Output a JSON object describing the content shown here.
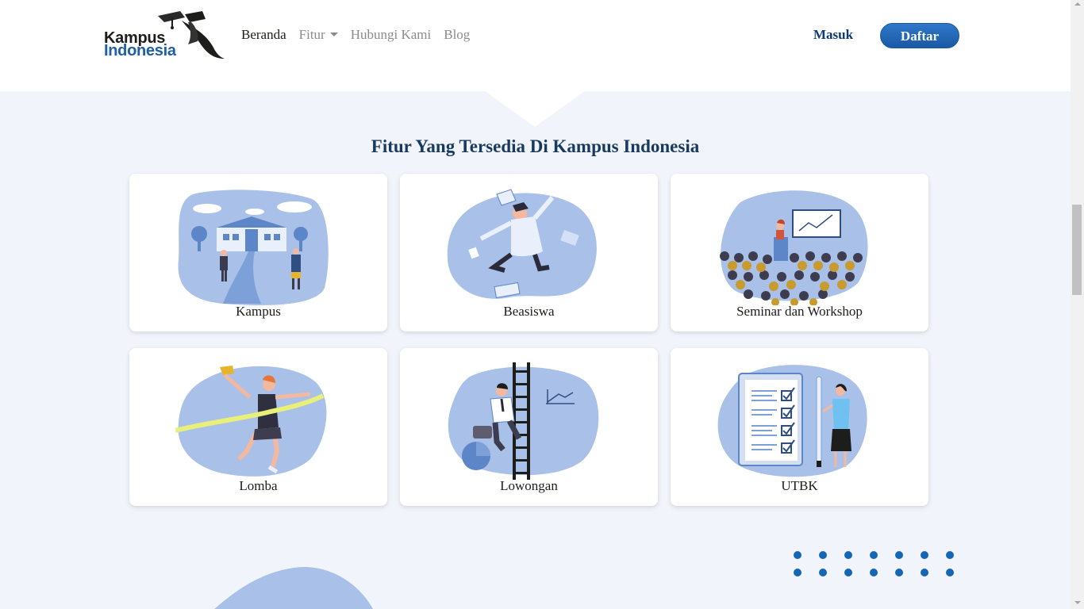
{
  "header": {
    "logo": {
      "line1": "Kampus",
      "line2": "Indonesia"
    },
    "nav": [
      {
        "label": "Beranda",
        "active": true
      },
      {
        "label": "Fitur",
        "dropdown": true
      },
      {
        "label": "Hubungi Kami"
      },
      {
        "label": "Blog"
      }
    ],
    "login_label": "Masuk",
    "register_label": "Daftar"
  },
  "features": {
    "title": "Fitur Yang Tersedia Di Kampus Indonesia",
    "cards": [
      {
        "label": "Kampus",
        "icon": "campus-illustration-icon"
      },
      {
        "label": "Beasiswa",
        "icon": "graduate-jumping-illustration-icon"
      },
      {
        "label": "Seminar dan Workshop",
        "icon": "seminar-audience-illustration-icon"
      },
      {
        "label": "Lomba",
        "icon": "runner-finish-line-illustration-icon"
      },
      {
        "label": "Lowongan",
        "icon": "career-ladder-illustration-icon"
      },
      {
        "label": "UTBK",
        "icon": "exam-checklist-illustration-icon"
      }
    ]
  },
  "colors": {
    "brand_dark": "#0f3c74",
    "brand_blue": "#1a5aa5",
    "page_bg": "#f1f4fa",
    "illustration_blue": "#a9c0e8",
    "dots": "#1466b4"
  }
}
